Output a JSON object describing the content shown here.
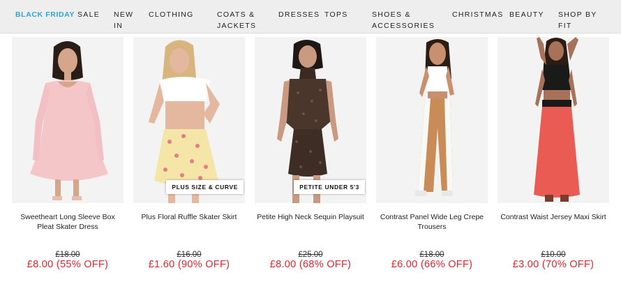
{
  "nav": {
    "items": [
      {
        "label": "BLACK FRIDAY"
      },
      {
        "label": "SALE"
      },
      {
        "label": "NEW\nIN"
      },
      {
        "label": "CLOTHING"
      },
      {
        "label": "COATS &\nJACKETS"
      },
      {
        "label": "DRESSES"
      },
      {
        "label": "TOPS"
      },
      {
        "label": "SHOES &\nACCESSORIES"
      },
      {
        "label": "CHRISTMAS"
      },
      {
        "label": "BEAUTY"
      },
      {
        "label": "SHOP BY\nFIT"
      }
    ],
    "highlight_color": "#2aa7d9"
  },
  "products": [
    {
      "name": "Sweetheart Long Sleeve Box Pleat Skater Dress",
      "was": "£18.00",
      "now": "£8.00  (55% OFF)",
      "badge": ""
    },
    {
      "name": "Plus Floral Ruffle Skater Skirt",
      "was": "£16.00",
      "now": "£1.60  (90% OFF)",
      "badge": "PLUS SIZE & CURVE"
    },
    {
      "name": "Petite High Neck Sequin Playsuit",
      "was": "£25.00",
      "now": "£8.00  (68% OFF)",
      "badge": "PETITE UNDER 5'3"
    },
    {
      "name": "Contrast Panel Wide Leg Crepe Trousers",
      "was": "£18.00",
      "now": "£6.00  (66% OFF)",
      "badge": ""
    },
    {
      "name": "Contrast Waist Jersey Maxi Skirt",
      "was": "£10.00",
      "now": "£3.00  (70% OFF)",
      "badge": ""
    }
  ],
  "colors": {
    "sale_price": "#e3242b",
    "nav_background": "#eeeeee"
  }
}
